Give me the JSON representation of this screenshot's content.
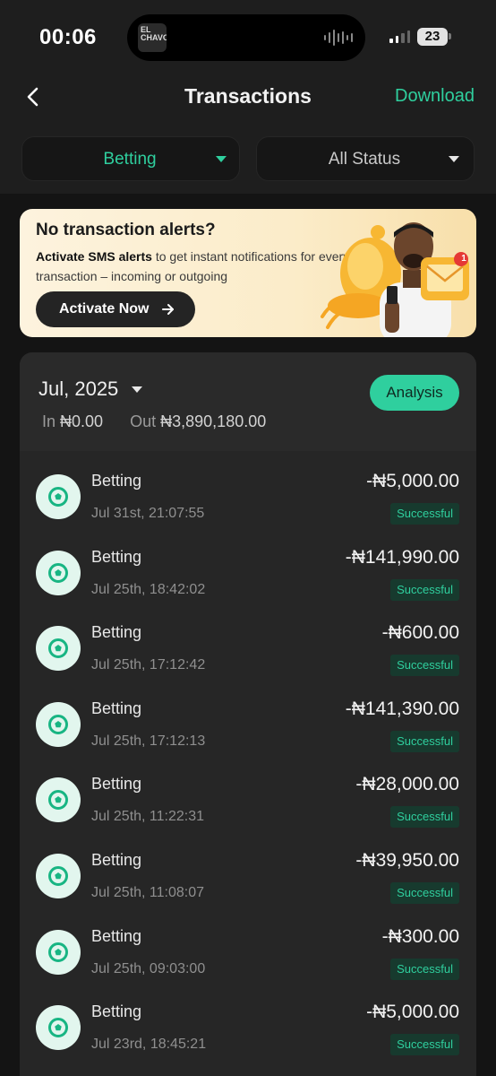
{
  "status_bar": {
    "time": "00:06",
    "now_playing_art_text": "EL CHAVO",
    "battery": "23"
  },
  "header": {
    "title": "Transactions",
    "download_label": "Download"
  },
  "filters": {
    "category": "Betting",
    "status": "All Status"
  },
  "banner": {
    "title": "No transaction alerts?",
    "text_bold": "Activate SMS alerts",
    "text_rest": " to get instant notifications for every transaction – incoming or outgoing",
    "button_label": "Activate Now",
    "envelope_badge": "1"
  },
  "summary": {
    "month": "Jul, 2025",
    "in_label": "In",
    "in_value": "₦0.00",
    "out_label": "Out",
    "out_value": "₦3,890,180.00",
    "analysis_label": "Analysis"
  },
  "transactions": [
    {
      "name": "Betting",
      "date": "Jul 31st, 21:07:55",
      "amount": "-₦5,000.00",
      "status": "Successful"
    },
    {
      "name": "Betting",
      "date": "Jul 25th, 18:42:02",
      "amount": "-₦141,990.00",
      "status": "Successful"
    },
    {
      "name": "Betting",
      "date": "Jul 25th, 17:12:42",
      "amount": "-₦600.00",
      "status": "Successful"
    },
    {
      "name": "Betting",
      "date": "Jul 25th, 17:12:13",
      "amount": "-₦141,390.00",
      "status": "Successful"
    },
    {
      "name": "Betting",
      "date": "Jul 25th, 11:22:31",
      "amount": "-₦28,000.00",
      "status": "Successful"
    },
    {
      "name": "Betting",
      "date": "Jul 25th, 11:08:07",
      "amount": "-₦39,950.00",
      "status": "Successful"
    },
    {
      "name": "Betting",
      "date": "Jul 25th, 09:03:00",
      "amount": "-₦300.00",
      "status": "Successful"
    },
    {
      "name": "Betting",
      "date": "Jul 23rd, 18:45:21",
      "amount": "-₦5,000.00",
      "status": "Successful"
    }
  ],
  "colors": {
    "accent": "#2fcf9e",
    "background": "#1e1e1e",
    "card": "#262626"
  },
  "icons": {
    "back": "chevron-left-icon",
    "betting": "soccer-ball-icon",
    "activate_arrow": "arrow-right-icon"
  }
}
